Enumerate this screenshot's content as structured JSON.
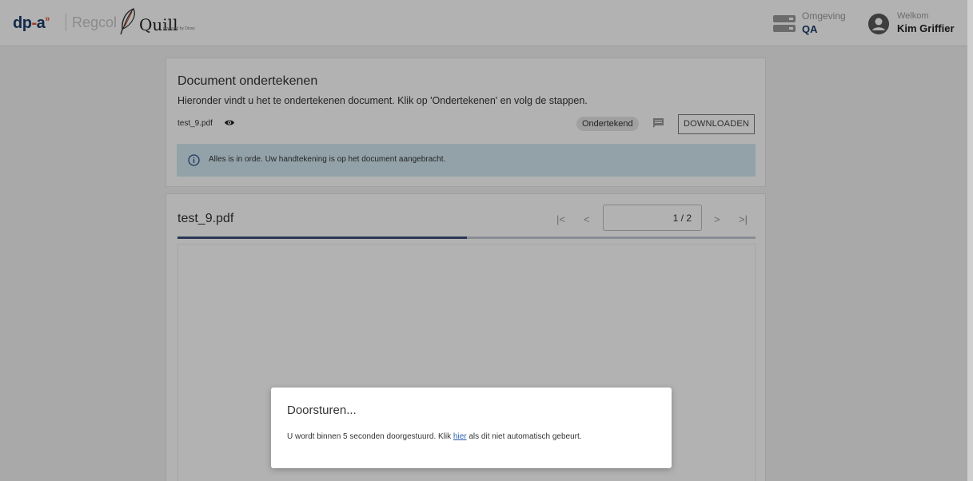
{
  "header": {
    "logo_dp": "dp",
    "logo_dash": "-",
    "logo_a": "a",
    "logo_arrows": "»",
    "logo_regcol": "Regcol",
    "logo_quill": "Quill",
    "logo_powered": "powered by Dioss",
    "environment_label": "Omgeving",
    "environment_value": "QA",
    "welcome_label": "Welkom",
    "user_name": "Kim Griffier"
  },
  "document_card": {
    "title": "Document ondertekenen",
    "subtitle": "Hieronder vindt u het te ondertekenen document. Klik op 'Ondertekenen' en volg de stappen.",
    "file_name": "test_9.pdf",
    "status_badge": "Ondertekend",
    "download_label": "DOWNLOADEN",
    "alert_text": "Alles is in orde. Uw handtekening is op het document aangebracht.",
    "icons": {
      "view": "eye-icon",
      "comment": "comment-icon",
      "info": "info-icon"
    }
  },
  "viewer": {
    "file_title": "test_9.pdf",
    "first_page": "|<",
    "prev_page": "<",
    "page_indicator": "1 / 2",
    "next_page": ">",
    "last_page": ">|",
    "page_current": 1,
    "page_total": 2,
    "progress_fraction": 0.5
  },
  "modal": {
    "title": "Doorsturen...",
    "text_before": "U wordt binnen 5 seconden doorgestuurd. Klik ",
    "link_text": "hier",
    "text_after": " als dit niet automatisch gebeurt."
  },
  "colors": {
    "brand_blue": "#1d3b6a",
    "brand_orange": "#e8502e",
    "alert_bg": "#d3e8f2",
    "progress_fill": "#3d4f7c",
    "link": "#2a5db0"
  }
}
